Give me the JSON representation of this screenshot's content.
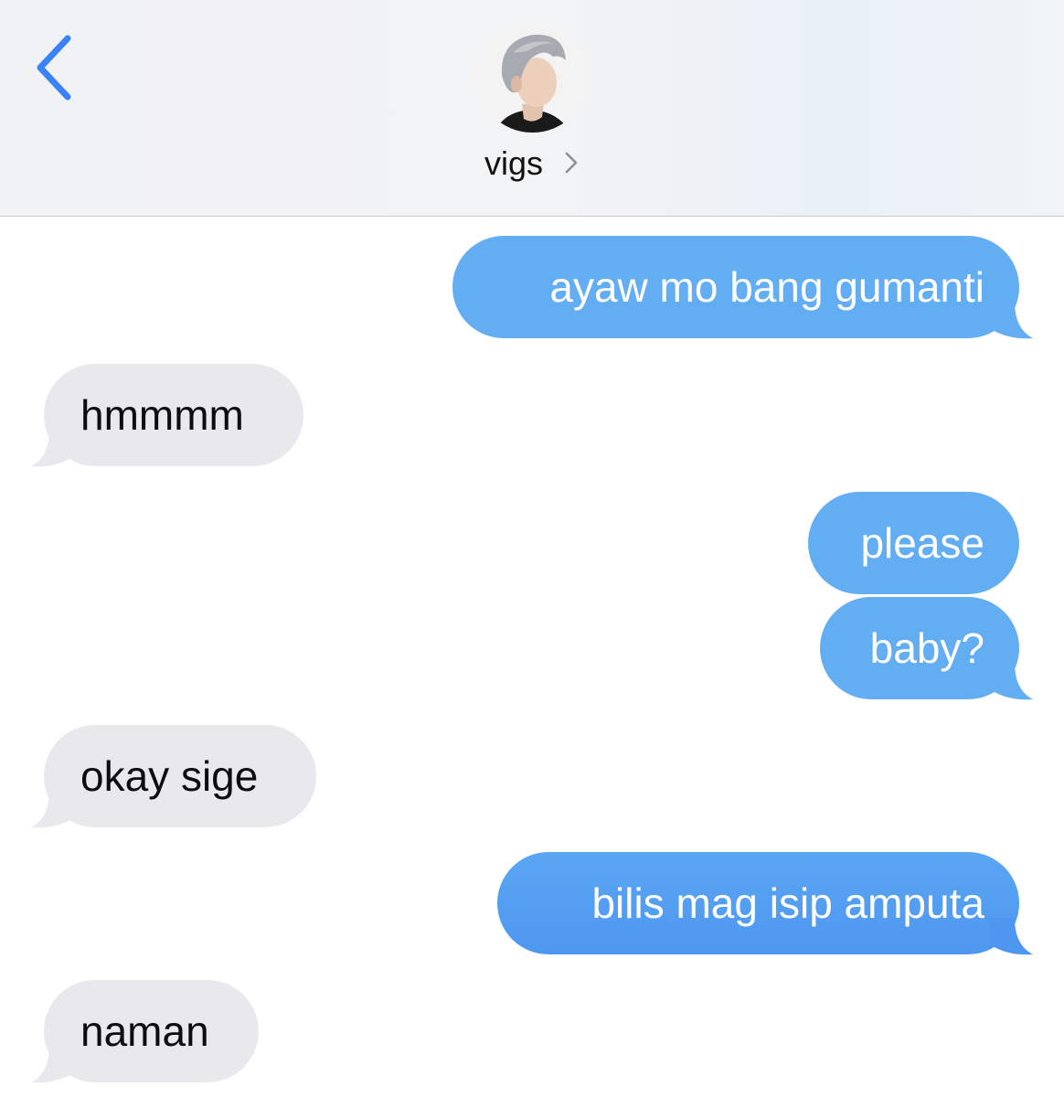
{
  "colors": {
    "sent_bubble": "#63adf3",
    "received_bubble": "#e9e9ed",
    "accent": "#3a82f7"
  },
  "header": {
    "contact_name": "vigs",
    "back_icon": "chevron-left-icon",
    "detail_icon": "chevron-right-icon"
  },
  "messages": [
    {
      "direction": "sent",
      "text": "ayaw mo bang gumanti"
    },
    {
      "direction": "received",
      "text": "hmmmm"
    },
    {
      "direction": "sent",
      "text": "please"
    },
    {
      "direction": "sent",
      "text": "baby?"
    },
    {
      "direction": "received",
      "text": "okay sige"
    },
    {
      "direction": "sent",
      "text": "bilis mag isip amputa"
    },
    {
      "direction": "received",
      "text": "naman"
    }
  ]
}
